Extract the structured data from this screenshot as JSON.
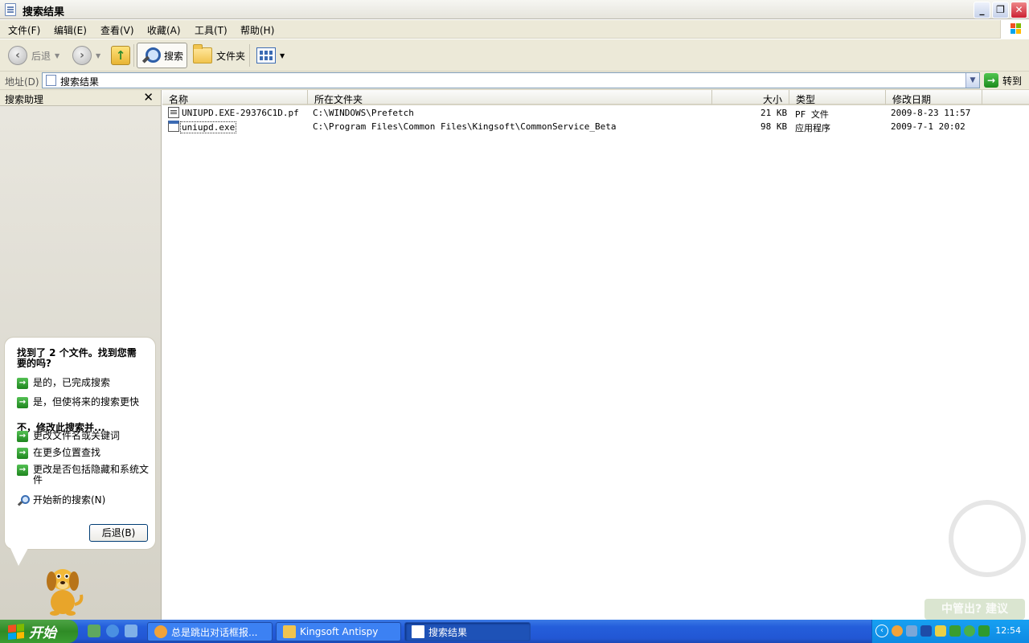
{
  "window": {
    "title": "搜索结果"
  },
  "menu": [
    {
      "label": "文件(F)"
    },
    {
      "label": "编辑(E)"
    },
    {
      "label": "查看(V)"
    },
    {
      "label": "收藏(A)"
    },
    {
      "label": "工具(T)"
    },
    {
      "label": "帮助(H)"
    }
  ],
  "toolbar": {
    "back": "后退",
    "search": "搜索",
    "folders": "文件夹"
  },
  "address": {
    "label": "地址(D)",
    "value": "搜索结果",
    "go": "转到"
  },
  "sidebar": {
    "title": "搜索助理",
    "close": "✕",
    "bubble_heading": "找到了 2 个文件。找到您需要的吗?",
    "links_yes": [
      "是的，已完成搜索",
      "是，但使将来的搜索更快"
    ],
    "section": "不，修改此搜索并...",
    "links_modify": [
      "更改文件名或关键词",
      "在更多位置查找",
      "更改是否包括隐藏和系统文件"
    ],
    "new_search": "开始新的搜索(N)",
    "back_button": "后退(B)"
  },
  "table": {
    "columns": [
      "名称",
      "所在文件夹",
      "大小",
      "类型",
      "修改日期"
    ],
    "rows": [
      {
        "name": "UNIUPD.EXE-29376C1D.pf",
        "folder": "C:\\WINDOWS\\Prefetch",
        "size": "21 KB",
        "type": "PF 文件",
        "date": "2009-8-23 11:57"
      },
      {
        "name": "uniupd.exe",
        "folder": "C:\\Program Files\\Common Files\\Kingsoft\\CommonService_Beta",
        "size": "98 KB",
        "type": "应用程序",
        "date": "2009-7-1 20:02"
      }
    ]
  },
  "taskbar": {
    "start": "开始",
    "tasks": [
      {
        "label": "总是跳出对话框报..."
      },
      {
        "label": "Kingsoft Antispy"
      },
      {
        "label": "搜索结果"
      }
    ],
    "clock": "12:54"
  },
  "watermark": "中管出? 建议",
  "colors": {
    "taskbar": "#245edb",
    "start": "#3a9d31",
    "accent": "#1f861f"
  }
}
